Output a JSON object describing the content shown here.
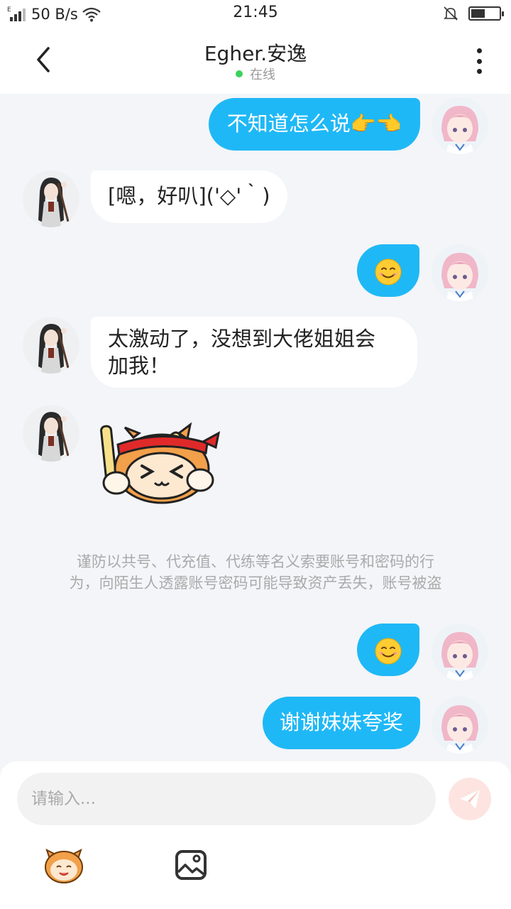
{
  "status_bar": {
    "net_speed": "50 B/s",
    "time": "21:45",
    "signal_tag": "E",
    "battery_level": 0.5
  },
  "header": {
    "title": "Egher.安逸",
    "presence": "在线"
  },
  "messages": [
    {
      "from": "me",
      "text": "不知道怎么说👉👈"
    },
    {
      "from": "them",
      "text": "[嗯，好叭]('◇'｀)"
    },
    {
      "from": "me",
      "type": "emoji",
      "icon": "smiling-face-icon"
    },
    {
      "from": "them",
      "text": "太激动了，没想到大佬姐姐会加我！"
    },
    {
      "from": "them",
      "type": "sticker",
      "icon": "drumming-monkey-sticker"
    },
    {
      "from": "me",
      "type": "emoji",
      "icon": "smiling-face-icon"
    },
    {
      "from": "me",
      "text": "谢谢妹妹夸奖"
    }
  ],
  "chat": {
    "msg1": "不知道怎么说👉👈",
    "msg2": "[嗯，好叭]('◇'｀)",
    "msg4_line1": "太激动了，没想到大佬姐姐会",
    "msg4_line2": "加我！",
    "msg7": "谢谢妹妹夸奖"
  },
  "warning": {
    "line1": "谨防以共号、代充值、代练等名义索要账号和密码的行",
    "line2": "为，向陌生人透露账号密码可能导致资产丢失，账号被盗"
  },
  "composer": {
    "placeholder": "请输入...",
    "value": ""
  },
  "colors": {
    "outgoing_bubble": "#1fb8f6",
    "incoming_bubble": "#ffffff",
    "background": "#f3f5f8",
    "online_dot": "#3ad25a"
  }
}
